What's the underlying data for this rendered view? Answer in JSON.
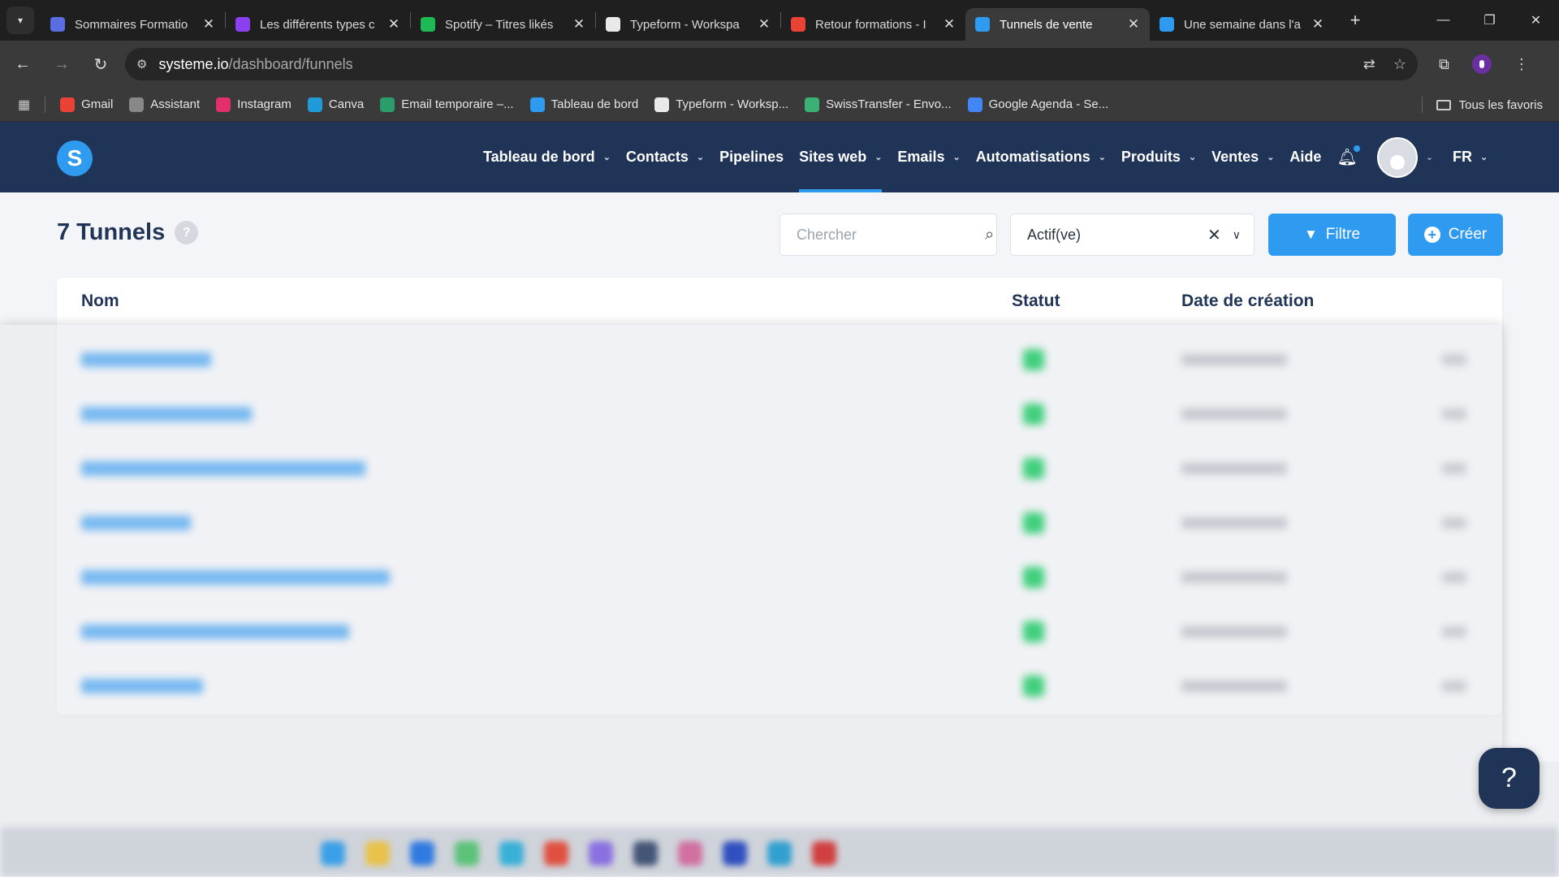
{
  "browser": {
    "tabs": [
      {
        "label": "Sommaires Formatio",
        "icon": "formation-doc-icon",
        "color": "#5b6ee1"
      },
      {
        "label": "Les différents types c",
        "icon": "canva-like-icon",
        "color": "#8a3ff0"
      },
      {
        "label": "Spotify – Titres likés",
        "icon": "spotify-icon",
        "color": "#1db954"
      },
      {
        "label": "Typeform - Workspa",
        "icon": "typeform-icon",
        "color": "#e9e9e9"
      },
      {
        "label": "Retour formations - I",
        "icon": "gmail-icon",
        "color": "#ea4335"
      },
      {
        "label": "Tunnels de vente",
        "icon": "systeme-icon",
        "color": "#2e9bf0",
        "active": true
      },
      {
        "label": "Une semaine dans l'a",
        "icon": "systeme-icon",
        "color": "#2e9bf0"
      }
    ],
    "url_host": "systeme.io",
    "url_path": "/dashboard/funnels",
    "bookmarks": [
      {
        "label": "Gmail",
        "icon": "gmail-icon",
        "color": "#ea4335"
      },
      {
        "label": "Assistant",
        "icon": "assistant-icon",
        "color": "#888888"
      },
      {
        "label": "Instagram",
        "icon": "instagram-icon",
        "color": "#e1306c"
      },
      {
        "label": "Canva",
        "icon": "canva-icon",
        "color": "#1f9bd9"
      },
      {
        "label": "Email temporaire –...",
        "icon": "temp-mail-icon",
        "color": "#2a9d6a"
      },
      {
        "label": "Tableau de bord",
        "icon": "systeme-icon",
        "color": "#2e9bf0"
      },
      {
        "label": "Typeform - Worksp...",
        "icon": "typeform-icon",
        "color": "#e9e9e9"
      },
      {
        "label": "SwissTransfer - Envo...",
        "icon": "swisstransfer-icon",
        "color": "#3bb273"
      },
      {
        "label": "Google Agenda - Se...",
        "icon": "google-calendar-icon",
        "color": "#4285f4"
      }
    ],
    "all_bookmarks": "Tous les favoris"
  },
  "app": {
    "logo": "S",
    "menu": [
      {
        "label": "Tableau de bord",
        "dropdown": true
      },
      {
        "label": "Contacts",
        "dropdown": true
      },
      {
        "label": "Pipelines",
        "dropdown": false
      },
      {
        "label": "Sites web",
        "dropdown": true,
        "active": true
      },
      {
        "label": "Emails",
        "dropdown": true
      },
      {
        "label": "Automatisations",
        "dropdown": true
      },
      {
        "label": "Produits",
        "dropdown": true
      },
      {
        "label": "Ventes",
        "dropdown": true
      },
      {
        "label": "Aide",
        "dropdown": false
      }
    ],
    "language": "FR",
    "accent_color": "#2e9bf0",
    "nav_color": "#1f3456"
  },
  "page": {
    "title": "7 Tunnels",
    "help": "?",
    "search_placeholder": "Chercher",
    "status_filter": "Actif(ve)",
    "filter_label": "Filtre",
    "create_label": "Créer",
    "columns": {
      "name": "Nom",
      "status": "Statut",
      "created": "Date de création"
    },
    "row_count": 7,
    "status_color": "#3fcf7c"
  },
  "help_fab": "?"
}
